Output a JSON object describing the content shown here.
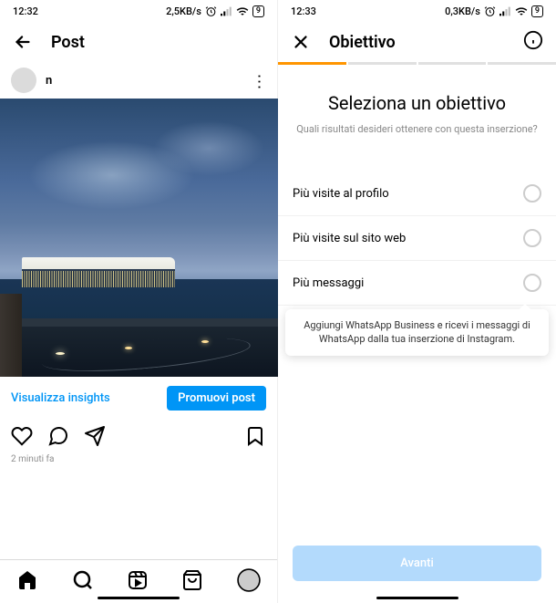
{
  "left": {
    "status": {
      "time": "12:32",
      "data_rate": "2,5KB/s",
      "battery": "9"
    },
    "header_title": "Post",
    "post": {
      "username": "n",
      "timestamp": "2 minuti fa"
    },
    "insights": {
      "link": "Visualizza insights",
      "promote": "Promuovi post"
    }
  },
  "right": {
    "status": {
      "time": "12:33",
      "data_rate": "0,3KB/s",
      "battery": "9"
    },
    "header_title": "Obiettivo",
    "goal": {
      "title": "Seleziona un obiettivo",
      "subtitle": "Quali risultati desideri ottenere con questa inserzione?"
    },
    "options": [
      {
        "label": "Più visite al profilo"
      },
      {
        "label": "Più visite sul sito web"
      },
      {
        "label": "Più messaggi"
      }
    ],
    "tooltip": "Aggiungi WhatsApp Business e ricevi i messaggi di WhatsApp dalla tua inserzione di Instagram.",
    "next_button": "Avanti"
  }
}
